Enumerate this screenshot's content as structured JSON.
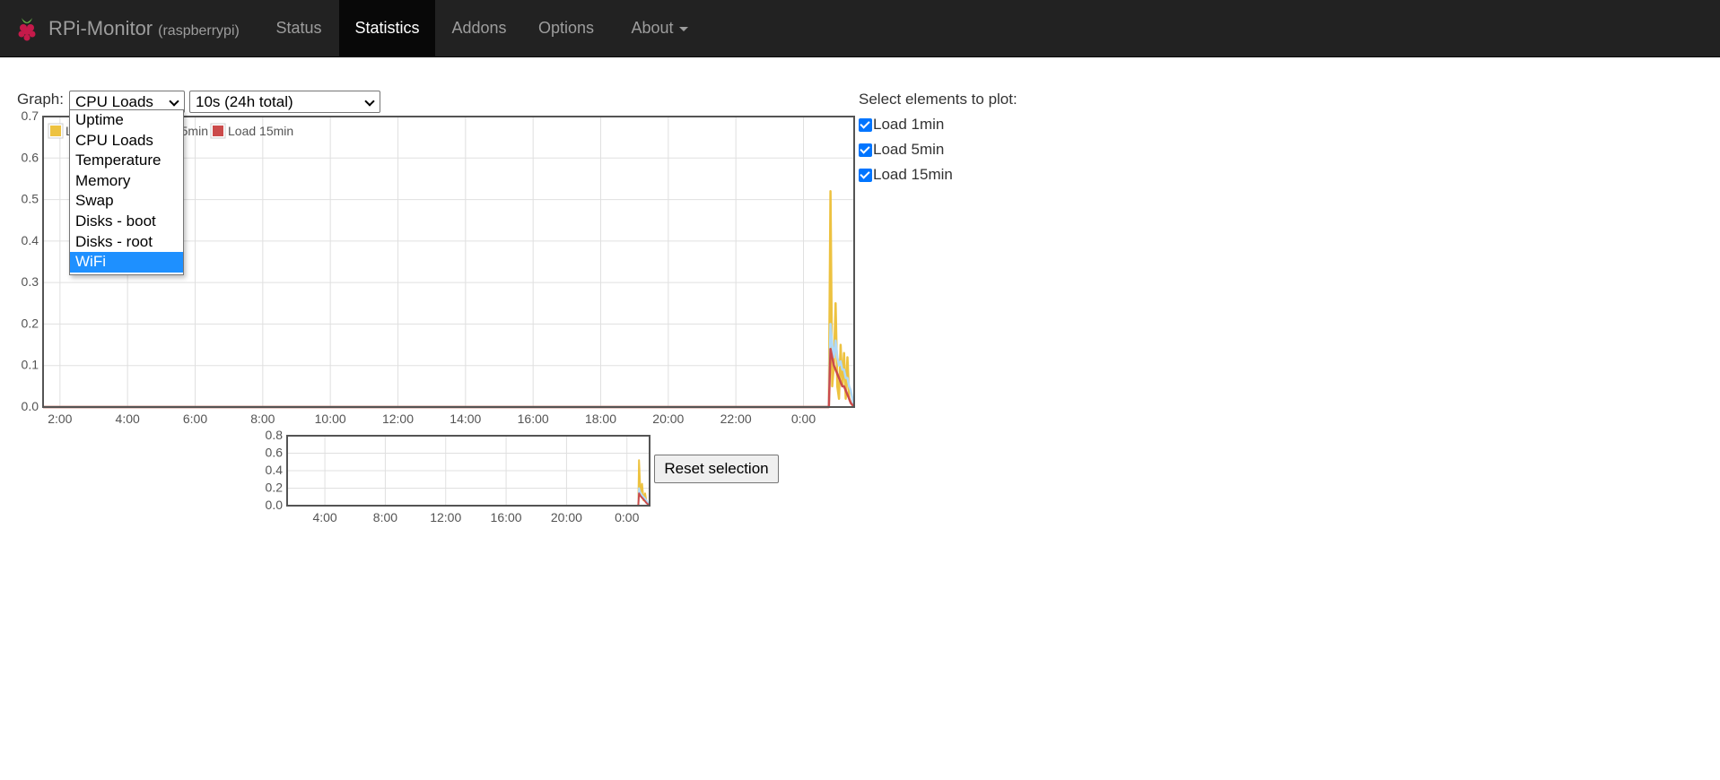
{
  "brand": {
    "name": "RPi-Monitor",
    "host": "(raspberrypi)"
  },
  "nav": {
    "status": "Status",
    "statistics": "Statistics",
    "addons": "Addons",
    "options": "Options",
    "about": "About"
  },
  "graph": {
    "label": "Graph:",
    "selected": "CPU Loads",
    "options": [
      "Uptime",
      "CPU Loads",
      "Temperature",
      "Memory",
      "Swap",
      "Disks - boot",
      "Disks - root",
      "WiFi"
    ],
    "highlighted_option": "WiFi",
    "period_selected": "10s (24h total)"
  },
  "plot_selection": {
    "title": "Select elements to plot:",
    "items": [
      {
        "label": "Load 1min",
        "checked": true
      },
      {
        "label": "Load 5min",
        "checked": true
      },
      {
        "label": "Load 15min",
        "checked": true
      }
    ]
  },
  "reset_button": "Reset selection",
  "colors": {
    "load1": "#edc240",
    "load5": "#afd8f8",
    "load15": "#cb4b4b",
    "navbar": "#222222",
    "accent": "#1e90ff"
  },
  "chart_data": [
    {
      "type": "line",
      "title": "",
      "xlabel": "",
      "ylabel": "",
      "x_ticks": [
        "2:00",
        "4:00",
        "6:00",
        "8:00",
        "10:00",
        "12:00",
        "14:00",
        "16:00",
        "18:00",
        "20:00",
        "22:00",
        "0:00"
      ],
      "y_ticks": [
        "0.0",
        "0.1",
        "0.2",
        "0.3",
        "0.4",
        "0.5",
        "0.6",
        "0.7"
      ],
      "ylim": [
        0,
        0.7
      ],
      "xlim_hours": [
        1.5,
        25.5
      ],
      "grid": true,
      "legend_position": "top-left",
      "legend_visible_labels": [
        "L",
        "5min",
        "Load 15min"
      ],
      "series": [
        {
          "name": "Load 1min",
          "x": [
            1.5,
            24.75,
            24.8,
            24.85,
            24.9,
            24.95,
            25.0,
            25.05,
            25.1,
            25.15,
            25.2,
            25.25,
            25.3,
            25.35,
            25.4,
            25.5
          ],
          "y": [
            0,
            0,
            0.52,
            0.05,
            0.1,
            0.25,
            0.05,
            0.02,
            0.15,
            0.05,
            0.13,
            0.02,
            0.12,
            0.02,
            0.01,
            0
          ]
        },
        {
          "name": "Load 5min",
          "x": [
            1.5,
            24.75,
            24.8,
            24.85,
            24.9,
            24.95,
            25.0,
            25.05,
            25.1,
            25.15,
            25.2,
            25.25,
            25.3,
            25.35,
            25.4,
            25.5
          ],
          "y": [
            0,
            0,
            0.2,
            0.15,
            0.12,
            0.16,
            0.12,
            0.1,
            0.11,
            0.09,
            0.09,
            0.07,
            0.07,
            0.05,
            0.04,
            0
          ]
        },
        {
          "name": "Load 15min",
          "x": [
            1.5,
            24.75,
            24.8,
            24.85,
            24.9,
            24.95,
            25.0,
            25.05,
            25.1,
            25.15,
            25.2,
            25.25,
            25.3,
            25.35,
            25.4,
            25.5
          ],
          "y": [
            0,
            0,
            0.14,
            0.12,
            0.1,
            0.09,
            0.08,
            0.07,
            0.06,
            0.05,
            0.05,
            0.04,
            0.03,
            0.02,
            0.01,
            0
          ]
        }
      ]
    },
    {
      "type": "line",
      "title": "",
      "xlabel": "",
      "ylabel": "",
      "x_ticks": [
        "4:00",
        "8:00",
        "12:00",
        "16:00",
        "20:00",
        "0:00"
      ],
      "y_ticks": [
        "0.0",
        "0.2",
        "0.4",
        "0.6",
        "0.8"
      ],
      "ylim": [
        0,
        0.8
      ],
      "xlim_hours": [
        1.5,
        25.5
      ],
      "grid": true,
      "series": [
        {
          "name": "Load 1min",
          "x": [
            1.5,
            24.75,
            24.8,
            24.9,
            25.0,
            25.1,
            25.2,
            25.3,
            25.5
          ],
          "y": [
            0,
            0,
            0.52,
            0.12,
            0.25,
            0.06,
            0.14,
            0.04,
            0
          ]
        },
        {
          "name": "Load 5min",
          "x": [
            1.5,
            24.75,
            24.8,
            24.9,
            25.0,
            25.1,
            25.2,
            25.3,
            25.5
          ],
          "y": [
            0,
            0,
            0.2,
            0.14,
            0.12,
            0.1,
            0.08,
            0.06,
            0
          ]
        },
        {
          "name": "Load 15min",
          "x": [
            1.5,
            24.75,
            24.8,
            24.9,
            25.0,
            25.1,
            25.2,
            25.3,
            25.5
          ],
          "y": [
            0,
            0,
            0.14,
            0.11,
            0.09,
            0.07,
            0.05,
            0.03,
            0
          ]
        }
      ]
    }
  ]
}
